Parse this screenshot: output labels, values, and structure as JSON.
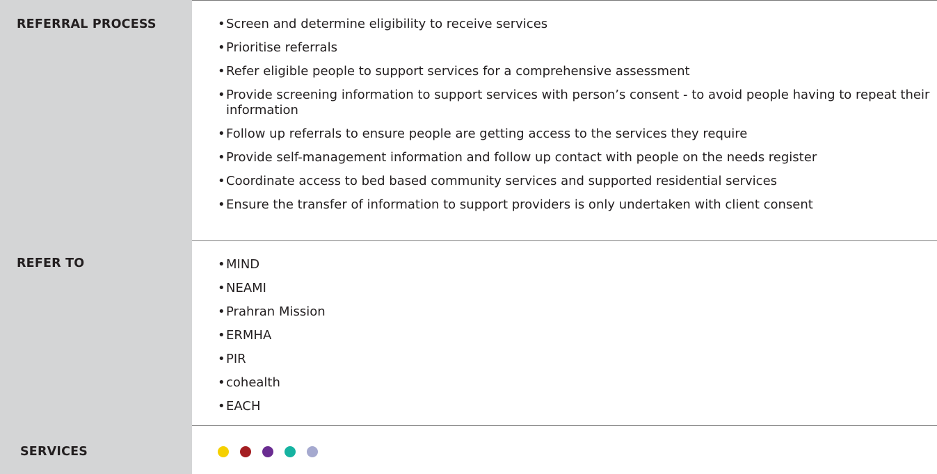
{
  "rows": [
    {
      "label": "REFERRAL PROCESS",
      "items": [
        "Screen and determine eligibility to receive services",
        "Prioritise referrals",
        "Refer eligible people to support services for a comprehensive assessment",
        "Provide screening information to support services with person’s consent - to avoid people having to repeat their information",
        "Follow up referrals to ensure people are getting access to the services they require",
        "Provide self-management information and follow up contact with people on the needs register",
        "Coordinate access to bed based community services and supported residential services",
        "Ensure the transfer of information to support providers is only undertaken with client consent"
      ]
    },
    {
      "label": "REFER TO",
      "items": [
        "MIND",
        "NEAMI",
        "Prahran Mission",
        "ERMHA",
        "PIR",
        "cohealth",
        "EACH"
      ]
    },
    {
      "label": "SERVICES",
      "dots": [
        "#f5d000",
        "#a41e22",
        "#6a2c91",
        "#16b3a1",
        "#a5a9cf"
      ]
    }
  ],
  "bullet_glyph": "•"
}
